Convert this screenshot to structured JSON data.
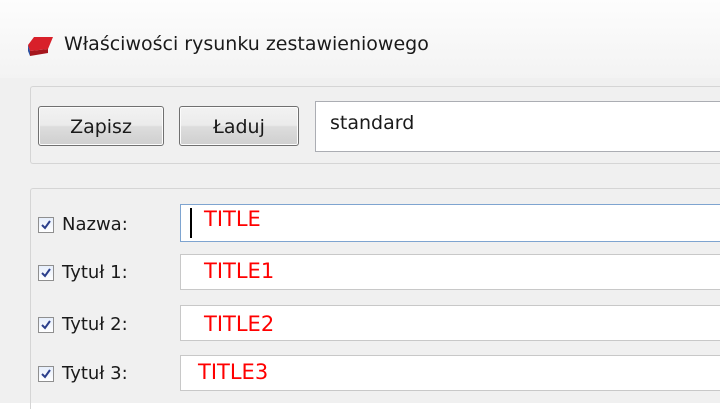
{
  "window": {
    "title": "Właściwości rysunku zestawieniowego"
  },
  "toolbar": {
    "save_label": "Zapisz",
    "load_label": "Ładuj",
    "profile_value": "standard"
  },
  "fields": [
    {
      "label": "Nazwa:",
      "value": "TITLE",
      "checked": true
    },
    {
      "label": "Tytuł 1:",
      "value": "TITLE1",
      "checked": true
    },
    {
      "label": "Tytuł 2:",
      "value": "TITLE2",
      "checked": true
    },
    {
      "label": "Tytuł 3:",
      "value": "TITLE3",
      "checked": true
    }
  ],
  "colors": {
    "field_text": "#ff0000",
    "icon_red": "#d8202a",
    "icon_blue": "#2a4fa0"
  }
}
